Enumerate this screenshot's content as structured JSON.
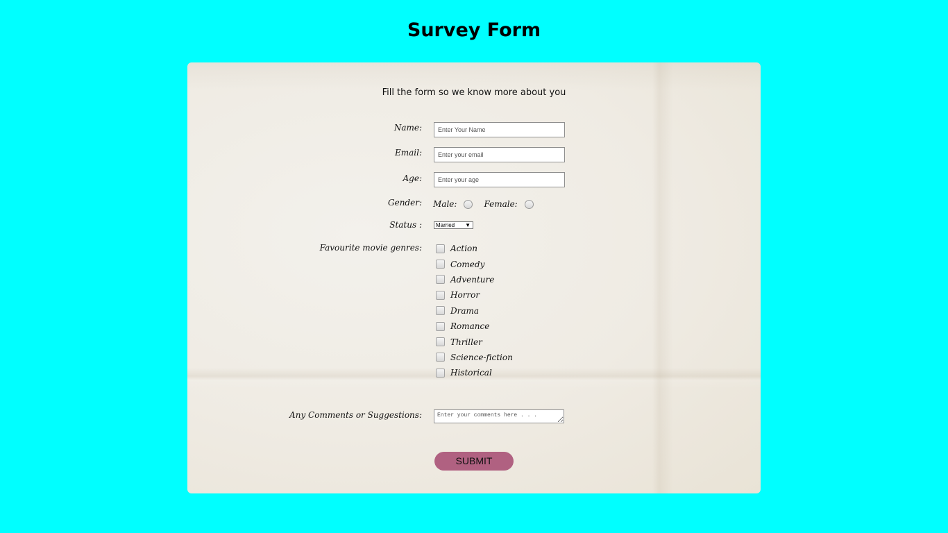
{
  "page": {
    "title": "Survey Form"
  },
  "form": {
    "subtitle": "Fill the form so we know more about you",
    "name": {
      "label": "Name:",
      "placeholder": "Enter Your Name"
    },
    "email": {
      "label": "Email:",
      "placeholder": "Enter your email"
    },
    "age": {
      "label": "Age:",
      "placeholder": "Enter your age"
    },
    "gender": {
      "label": "Gender:",
      "options": [
        "Male:",
        "Female:"
      ]
    },
    "status": {
      "label": "Status :",
      "selected": "Married",
      "arrow": "▼"
    },
    "genres": {
      "label": "Favourite movie genres:",
      "options": [
        "Action",
        "Comedy",
        "Adventure",
        "Horror",
        "Drama",
        "Romance",
        "Thriller",
        "Science-fiction",
        "Historical"
      ]
    },
    "comments": {
      "label": "Any Comments or Suggestions:",
      "placeholder": "Enter your comments here . . ."
    },
    "submit_label": "SUBMIT"
  },
  "colors": {
    "page_background": "#00ffff",
    "submit_button": "#b06181"
  }
}
